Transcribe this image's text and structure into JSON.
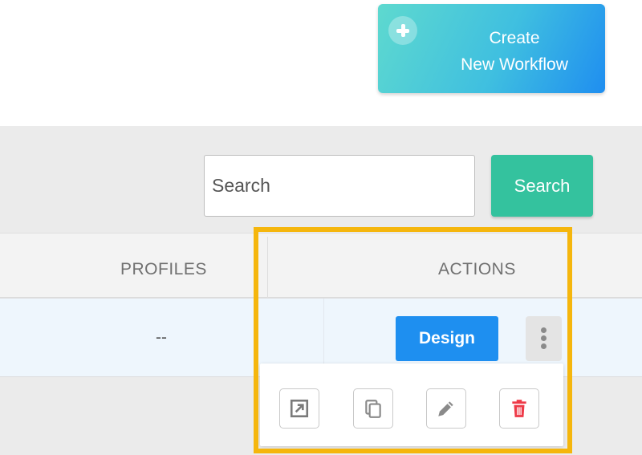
{
  "header": {
    "create_button": {
      "line1": "Create",
      "line2": "New Workflow",
      "icon": "plus-icon"
    }
  },
  "search": {
    "placeholder": "Search",
    "button_label": "Search"
  },
  "table": {
    "columns": [
      "PROFILES",
      "ACTIONS"
    ],
    "rows": [
      {
        "profiles": "--",
        "design_label": "Design"
      }
    ]
  },
  "action_menu": {
    "icons": [
      "open-external-icon",
      "copy-icon",
      "edit-pencil-icon",
      "trash-icon"
    ]
  },
  "colors": {
    "create_gradient_start": "#5ed9cf",
    "create_gradient_end": "#1f8ef0",
    "search_button": "#34c29e",
    "design_button": "#1e8ff0",
    "delete_icon": "#ee3a48",
    "highlight": "#f5b60d"
  }
}
